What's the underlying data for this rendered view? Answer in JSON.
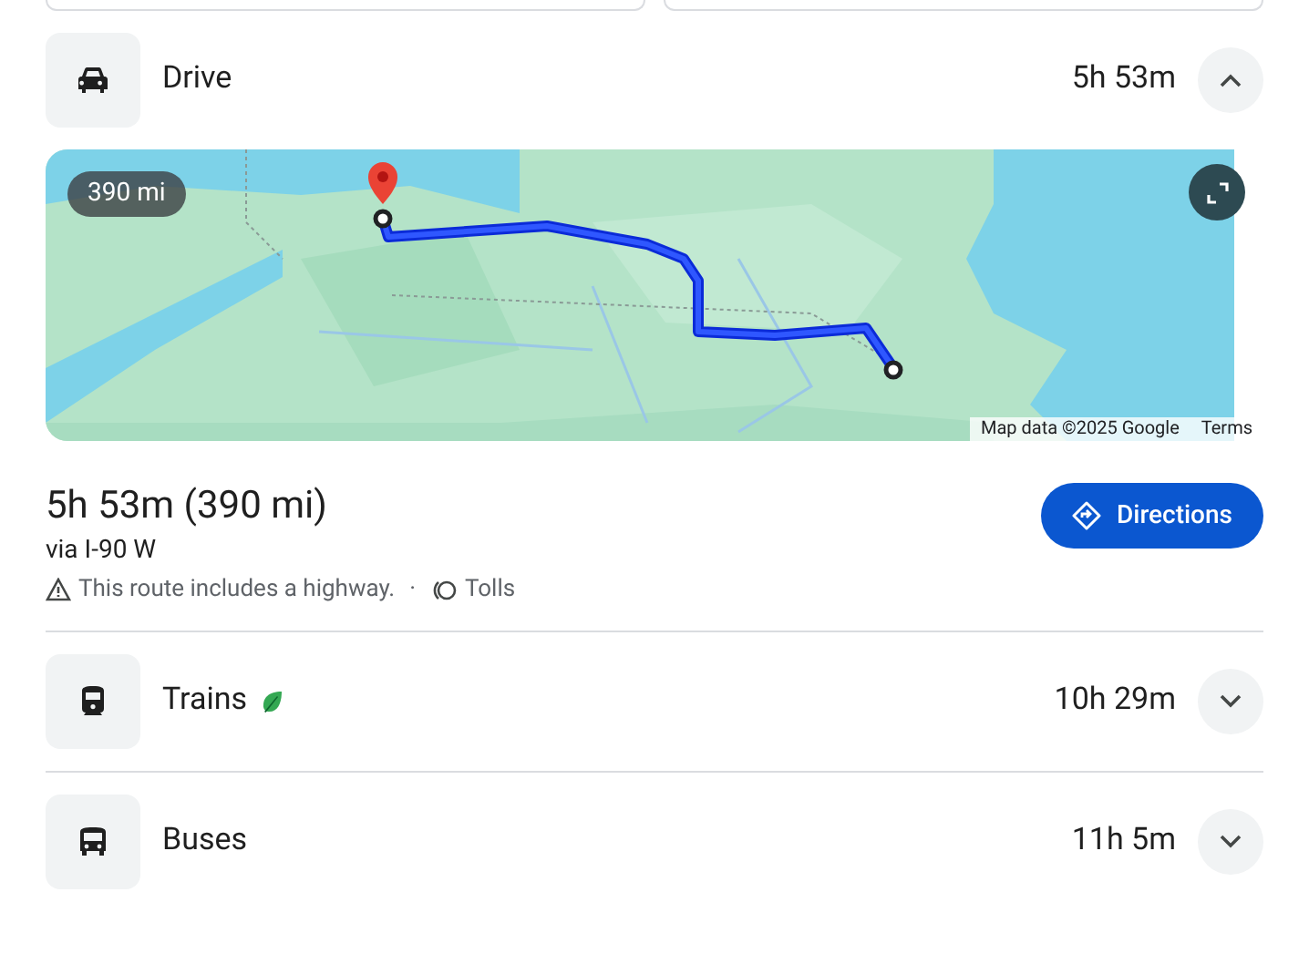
{
  "modes": [
    {
      "kind": "car",
      "label": "Drive",
      "eco": false,
      "duration": "5h 53m",
      "expanded": true,
      "details": {
        "map": {
          "distance_badge": "390 mi",
          "attribution": "Map data ©2025 Google",
          "terms": "Terms"
        },
        "summary": "5h 53m (390 mi)",
        "via": "via I-90 W",
        "warning": "This route includes a highway.",
        "separator": "·",
        "tolls": "Tolls",
        "button": "Directions"
      }
    },
    {
      "kind": "train",
      "label": "Trains",
      "eco": true,
      "duration": "10h 29m",
      "expanded": false
    },
    {
      "kind": "bus",
      "label": "Buses",
      "eco": false,
      "duration": "11h 5m",
      "expanded": false
    }
  ]
}
